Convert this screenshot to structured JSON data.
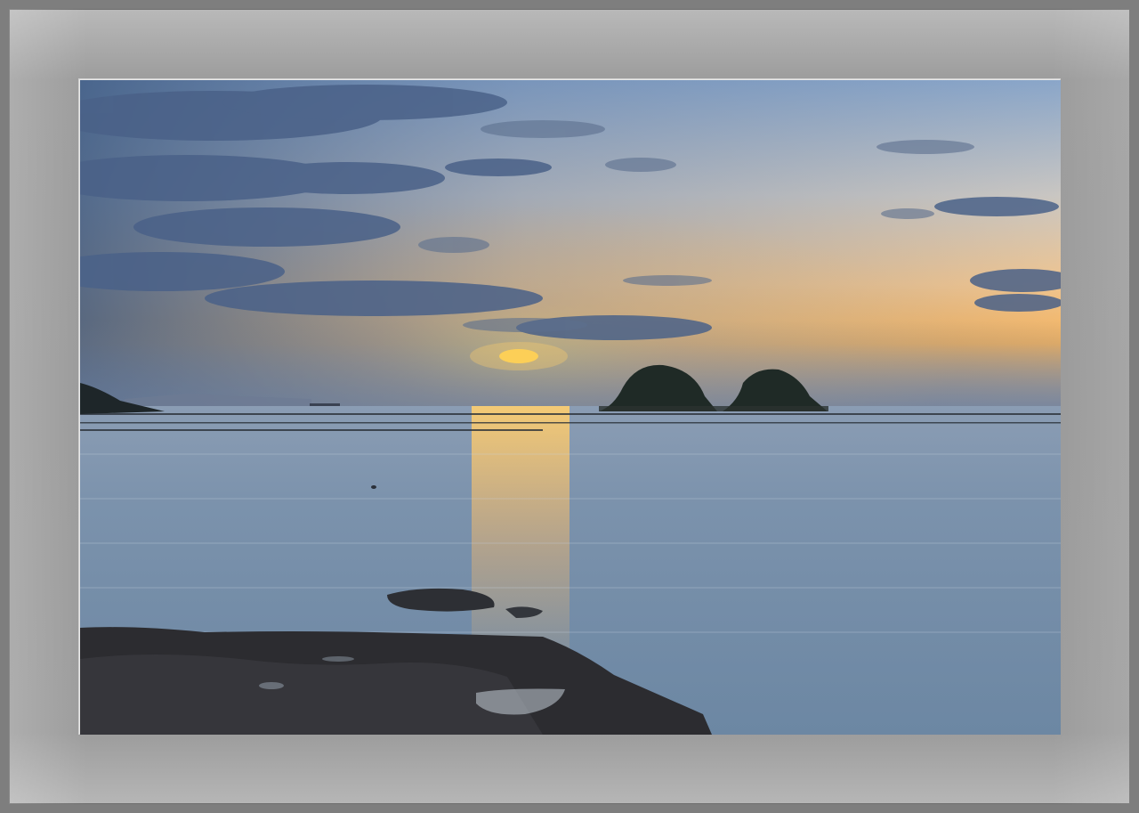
{
  "photo": {
    "subject": "seascape-sunrise",
    "colors": {
      "sky_top": "#6f8bb0",
      "sky_glow": "#f4c486",
      "sun": "#ffd24a",
      "sea": "#6e8aa6",
      "rocks": "#2c2c30",
      "islets": "#1f2a26"
    }
  }
}
